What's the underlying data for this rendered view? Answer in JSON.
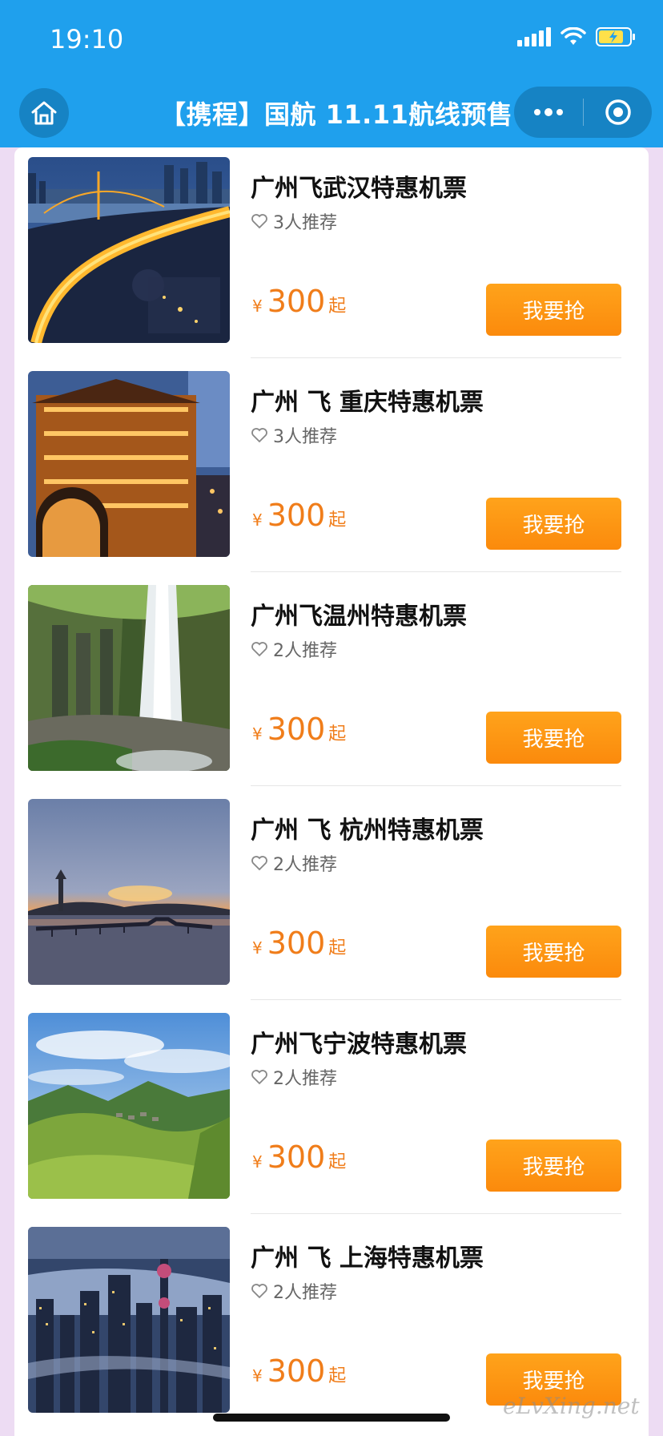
{
  "status_bar": {
    "time": "19:10"
  },
  "nav": {
    "title": "【携程】国航 11.11航线预售",
    "accent": "#1fa0ed"
  },
  "items": [
    {
      "title": "广州飞武汉特惠机票",
      "likes": "3人推荐",
      "currency": "¥",
      "price": "300",
      "price_suffix": "起",
      "button": "我要抢",
      "image": "wuhan-bridge-night"
    },
    {
      "title": "广州 飞 重庆特惠机票",
      "likes": "3人推荐",
      "currency": "¥",
      "price": "300",
      "price_suffix": "起",
      "button": "我要抢",
      "image": "chongqing-hongyadong"
    },
    {
      "title": "广州飞温州特惠机票",
      "likes": "2人推荐",
      "currency": "¥",
      "price": "300",
      "price_suffix": "起",
      "button": "我要抢",
      "image": "wenzhou-waterfall"
    },
    {
      "title": "广州 飞 杭州特惠机票",
      "likes": "2人推荐",
      "currency": "¥",
      "price": "300",
      "price_suffix": "起",
      "button": "我要抢",
      "image": "hangzhou-west-lake"
    },
    {
      "title": "广州飞宁波特惠机票",
      "likes": "2人推荐",
      "currency": "¥",
      "price": "300",
      "price_suffix": "起",
      "button": "我要抢",
      "image": "ningbo-mountains"
    },
    {
      "title": "广州 飞 上海特惠机票",
      "likes": "2人推荐",
      "currency": "¥",
      "price": "300",
      "price_suffix": "起",
      "button": "我要抢",
      "image": "shanghai-skyline"
    }
  ],
  "colors": {
    "price": "#f07d1a",
    "button": "#fb8a0c"
  },
  "watermark": "eLvXing.net"
}
